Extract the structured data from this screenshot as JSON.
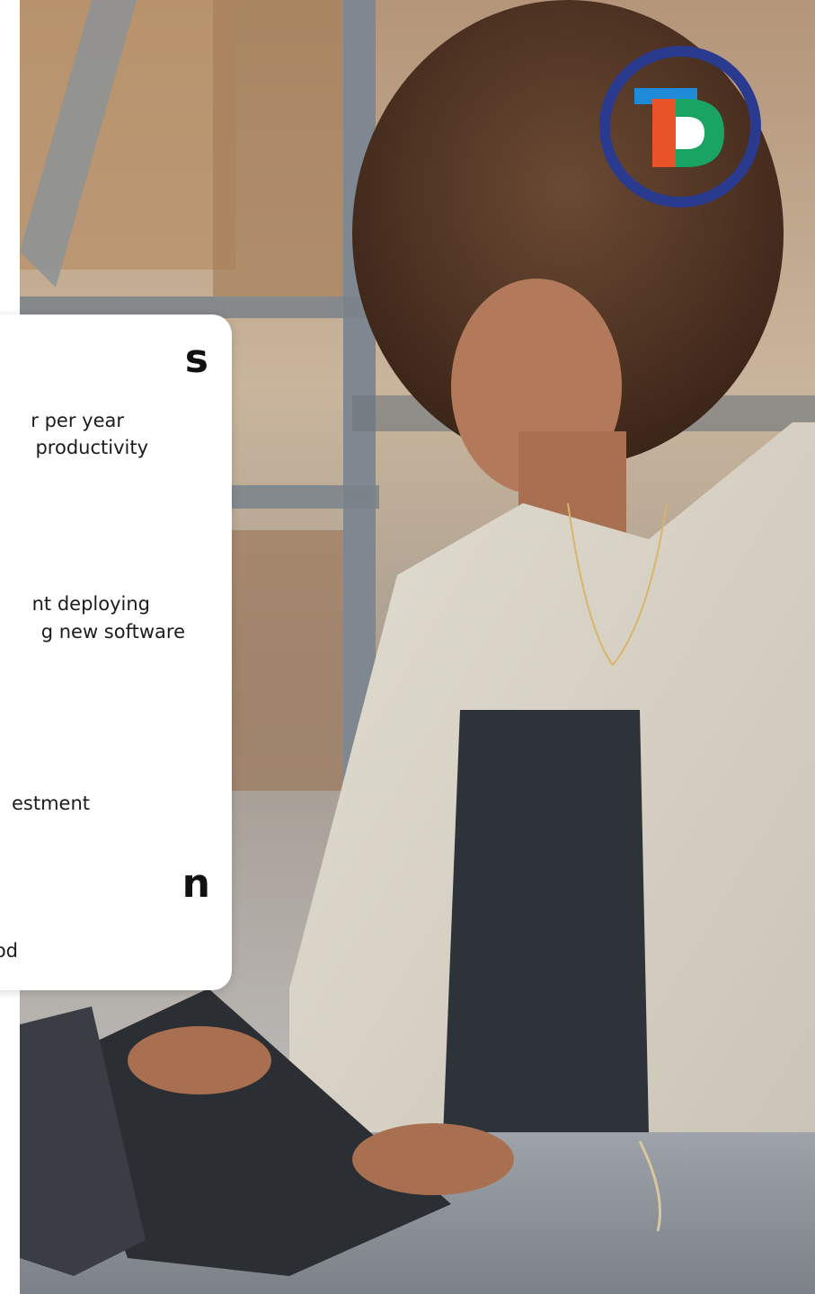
{
  "card": {
    "stat1": {
      "head": "s",
      "lines": [
        "r per year",
        "productivity"
      ]
    },
    "stat2": {
      "lines": [
        "nt deploying",
        "g new software"
      ]
    },
    "stat3": {
      "lines": [
        "estment"
      ]
    },
    "stat4": {
      "head": "n",
      "lines": [
        "od"
      ]
    }
  },
  "logo": {
    "icon": "company-logo-icon",
    "colors": {
      "ring": "#2a3b8f",
      "orange": "#e8532a",
      "green": "#1aa463",
      "blue": "#1e8ad8"
    }
  },
  "colors": {
    "card_bg": "#ffffff",
    "text": "#111111"
  }
}
